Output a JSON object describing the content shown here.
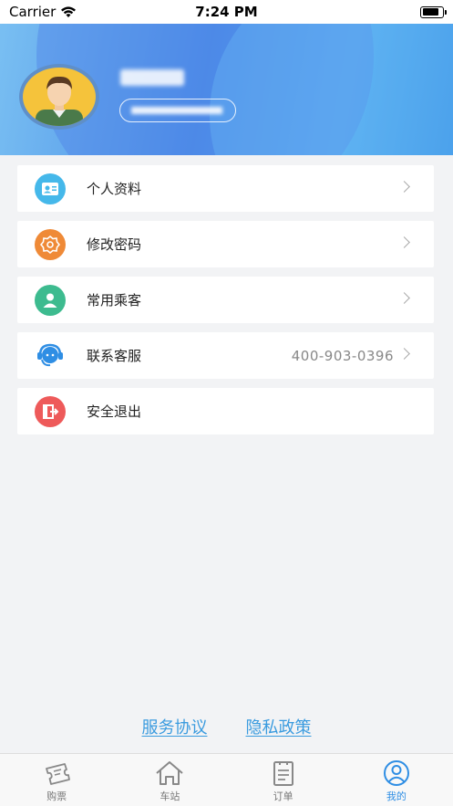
{
  "status_bar": {
    "carrier": "Carrier",
    "time": "7:24 PM"
  },
  "profile": {
    "username": "",
    "user_id": ""
  },
  "menu": [
    {
      "label": "个人资料",
      "icon": "profile-card-icon",
      "color": "#45b8ea"
    },
    {
      "label": "修改密码",
      "icon": "password-icon",
      "color": "#ef8a37"
    },
    {
      "label": "常用乘客",
      "icon": "passenger-icon",
      "color": "#3dbb8f"
    },
    {
      "label": "联系客服",
      "icon": "customer-service-icon",
      "color": "#2f8ee4",
      "value": "400-903-0396"
    },
    {
      "label": "安全退出",
      "icon": "logout-icon",
      "color": "#ee5a5a"
    }
  ],
  "links": {
    "service_agreement": "服务协议",
    "privacy_policy": "隐私政策"
  },
  "tabs": [
    {
      "label": "购票",
      "icon": "ticket-icon"
    },
    {
      "label": "车站",
      "icon": "home-icon"
    },
    {
      "label": "订单",
      "icon": "clipboard-icon"
    },
    {
      "label": "我的",
      "icon": "user-circle-icon",
      "active": true
    }
  ],
  "colors": {
    "accent": "#2f8ee4",
    "link": "#3a9bdf",
    "background": "#f2f3f5"
  }
}
